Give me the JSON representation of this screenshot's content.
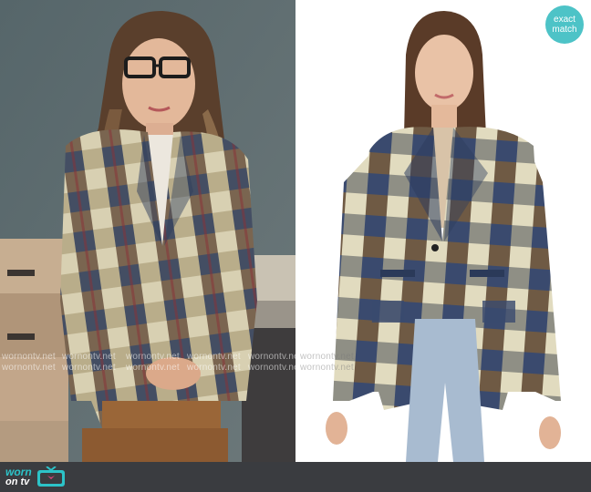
{
  "badge": {
    "line1": "exact",
    "line2": "match"
  },
  "watermark": {
    "text": "wornontv.net"
  },
  "brand": {
    "worn": "worn",
    "on_tv": "on tv"
  },
  "colors": {
    "wall": "#5f6c70",
    "blazer_navy": "#2f3d5c",
    "blazer_tan": "#c9bf96",
    "blazer_brown": "#6e5a43",
    "badge": "#4dc3c7",
    "footer": "#3a3c40"
  }
}
